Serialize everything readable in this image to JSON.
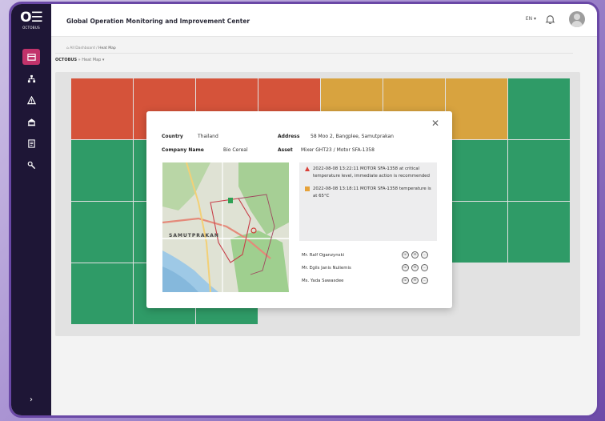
{
  "app": {
    "title": "Global Operation Monitoring and Improvement Center",
    "logo_text": "OCTOBUS",
    "language": "EN ▾"
  },
  "breadcrumb": {
    "root": "All Dashboard",
    "sep": "/",
    "current": "Heat Map"
  },
  "page_header": {
    "company": "OCTOBUS",
    "view": "» Heat Map ▾"
  },
  "sidebar": {
    "items": [
      {
        "icon": "dashboard-icon",
        "active": true
      },
      {
        "icon": "network-icon",
        "active": false
      },
      {
        "icon": "alert-icon",
        "active": false
      },
      {
        "icon": "building-icon",
        "active": false
      },
      {
        "icon": "report-icon",
        "active": false
      },
      {
        "icon": "wrench-icon",
        "active": false
      }
    ],
    "expand_label": "›"
  },
  "heatmap": {
    "colors": {
      "red": "#d5533a",
      "orange": "#d8a33f",
      "green": "#2f9b67"
    },
    "rows": [
      [
        "red",
        "red",
        "red",
        "red",
        "orange",
        "orange",
        "orange",
        "green"
      ],
      [
        "green",
        "green",
        "green",
        "green",
        "green",
        "green",
        "green",
        "green"
      ],
      [
        "green",
        "green",
        "green",
        "green",
        "green",
        "green",
        "green",
        "green"
      ],
      [
        "green",
        "green",
        "green",
        "",
        "",
        "",
        "",
        ""
      ]
    ]
  },
  "modal": {
    "close": "✕",
    "country_label": "Country",
    "country_value": "Thailand",
    "address_label": "Address",
    "address_value": "58 Moo 2, Bangplee, Samutprakan",
    "company_label": "Company Name",
    "company_value": "Bio Cereal",
    "asset_label": "Asset",
    "asset_value": "Mixer GHT23 / Motor SFA-1358",
    "map_label": "SAMUTPRAKAN",
    "alerts": [
      {
        "level": "critical",
        "color": "#d9413a",
        "text": "2022-08-08 13:22:11 MOTOR SFA-1358 at critical temperature level, immediate action is recommended"
      },
      {
        "level": "warning",
        "color": "#e6a23a",
        "text": "2022-08-08 13:18:11 MOTOR SFA-1358 temperature is at 65°C"
      }
    ],
    "contacts": [
      {
        "name": "Mr. Ralf Oganzynski"
      },
      {
        "name": "Mr. Egils Janis Nuliemis"
      },
      {
        "name": "Ms. Yada Sawasdee"
      }
    ]
  }
}
